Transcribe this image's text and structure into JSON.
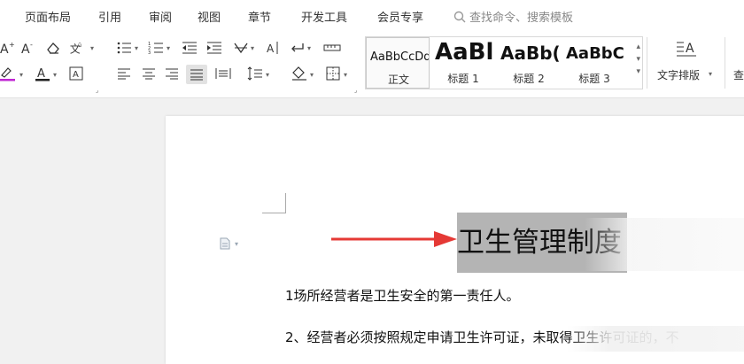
{
  "menu": {
    "items": [
      "页面布局",
      "引用",
      "审阅",
      "视图",
      "章节",
      "开发工具",
      "会员专享"
    ],
    "search_placeholder": "查找命令、搜索模板"
  },
  "ribbon": {
    "styles": [
      {
        "sample": "AaBbCcDd",
        "name": "正文"
      },
      {
        "sample": "AaBl",
        "name": "标题 1"
      },
      {
        "sample": "AaBb(",
        "name": "标题 2"
      },
      {
        "sample": "AaBbC",
        "name": "标题 3"
      }
    ],
    "text_layout_label": "文字排版",
    "text_layout_icon_text": "A",
    "char_border_icon_text": "A",
    "font_color": "#222222",
    "highlight_color": "#c026d3"
  },
  "document": {
    "title": "卫生管理制度",
    "paragraphs": [
      "1场所经营者是卫生安全的第一责任人。",
      "2、经营者必须按照规定申请卫生许可证，未取得卫生许可证的，不"
    ],
    "arrow_color": "#e53935"
  }
}
